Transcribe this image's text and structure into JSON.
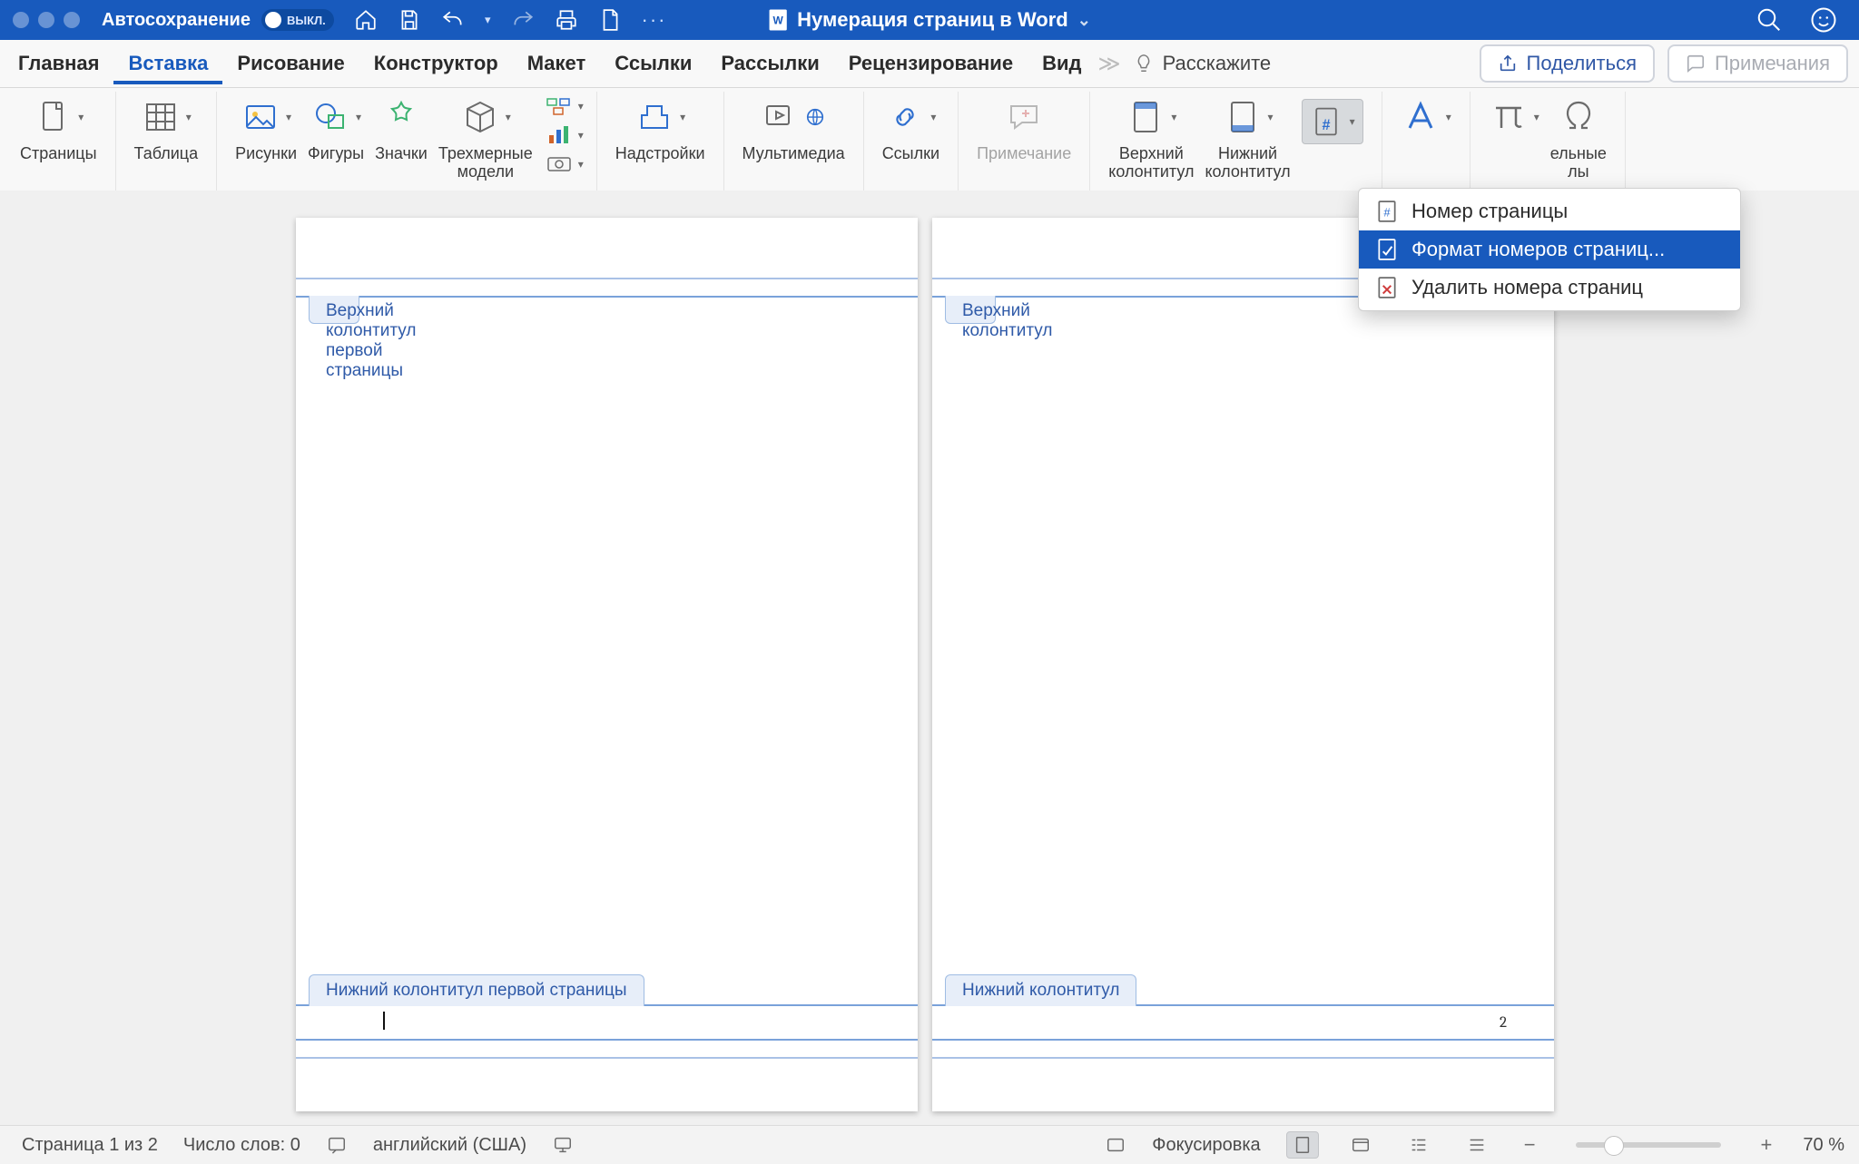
{
  "titlebar": {
    "autosave_label": "Автосохранение",
    "autosave_state": "ВЫКЛ.",
    "doc_title": "Нумерация страниц в Word"
  },
  "tabs": {
    "items": [
      "Главная",
      "Вставка",
      "Рисование",
      "Конструктор",
      "Макет",
      "Ссылки",
      "Рассылки",
      "Рецензирование",
      "Вид"
    ],
    "active_index": 1,
    "tell_me": "Расскажите"
  },
  "top_right": {
    "share": "Поделиться",
    "comments": "Примечания"
  },
  "ribbon": {
    "pages": "Страницы",
    "table": "Таблица",
    "pictures": "Рисунки",
    "shapes": "Фигуры",
    "icons": "Значки",
    "models3d": "Трехмерные\nмодели",
    "addins": "Надстройки",
    "media": "Мультимедиа",
    "links": "Ссылки",
    "comment": "Примечание",
    "header": "Верхний\nколонтитул",
    "footer": "Нижний\nколонтитул",
    "trailing_label": "ельные\nлы"
  },
  "dropdown": {
    "items": [
      "Номер страницы",
      "Формат номеров страниц...",
      "Удалить номера страниц"
    ],
    "selected_index": 1
  },
  "pages": {
    "header_first": "Верхний колонтитул первой страницы",
    "header": "Верхний колонтитул",
    "footer_first": "Нижний колонтитул первой страницы",
    "footer": "Нижний колонтитул",
    "page2_num": "2"
  },
  "status": {
    "page": "Страница 1 из 2",
    "words": "Число слов: 0",
    "lang": "английский (США)",
    "focus": "Фокусировка",
    "zoom": "70 %",
    "slider_pct": 26
  }
}
